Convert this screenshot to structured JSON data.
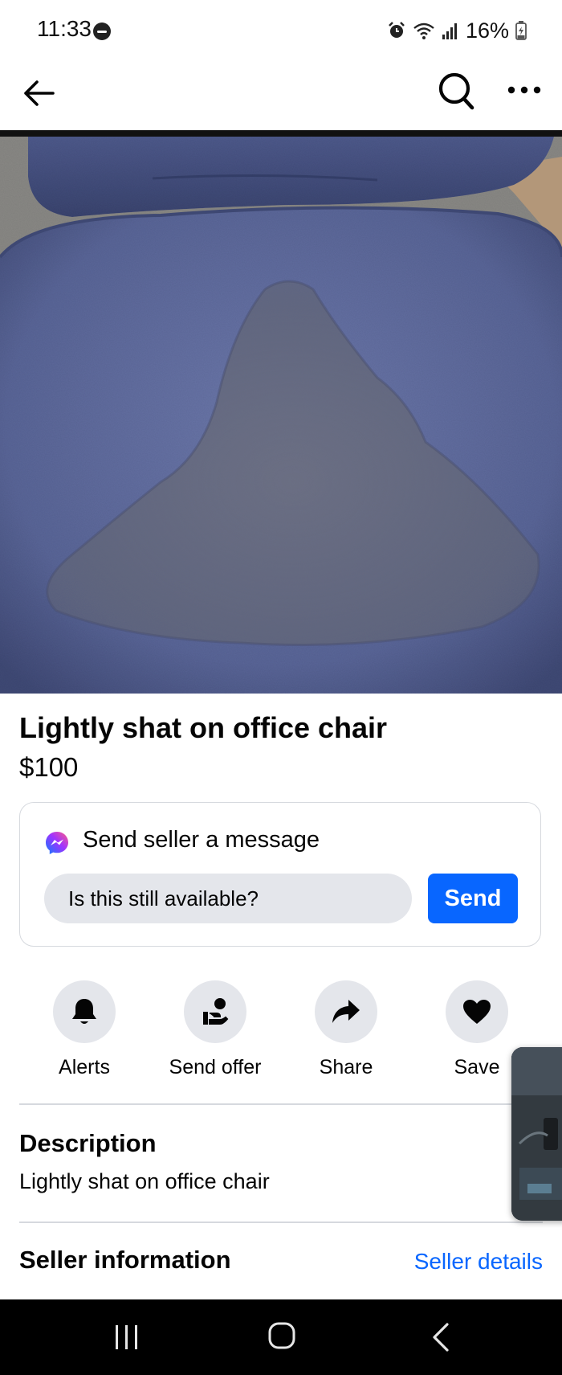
{
  "status_bar": {
    "time": "11:33",
    "battery_percent": "16%",
    "icons": [
      "do-not-disturb-icon",
      "alarm-icon",
      "wifi-icon",
      "signal-icon",
      "battery-charging-icon"
    ]
  },
  "app_bar": {
    "icons": [
      "back-arrow-icon",
      "search-icon",
      "more-options-icon"
    ]
  },
  "listing": {
    "title": "Lightly shat on office chair",
    "price": "$100"
  },
  "message": {
    "heading": "Send seller a message",
    "input_value": "Is this still available?",
    "send_label": "Send",
    "accent_color": "#0866ff"
  },
  "actions": [
    {
      "label": "Alerts",
      "icon": "bell-icon"
    },
    {
      "label": "Send offer",
      "icon": "offer-hand-icon"
    },
    {
      "label": "Share",
      "icon": "share-arrow-icon"
    },
    {
      "label": "Save",
      "icon": "heart-icon"
    }
  ],
  "description": {
    "heading": "Description",
    "text": "Lightly shat on office chair"
  },
  "seller": {
    "heading": "Seller information",
    "link_label": "Seller details"
  },
  "nav_bar": {
    "icons": [
      "recents-icon",
      "home-icon",
      "system-back-icon"
    ]
  }
}
